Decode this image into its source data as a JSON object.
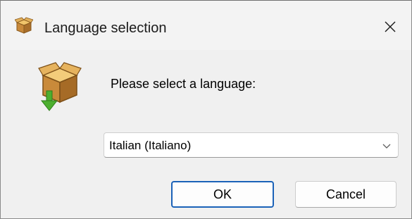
{
  "window": {
    "title": "Language selection",
    "icon": "installer-box-icon",
    "close_icon": "close-icon"
  },
  "dialog": {
    "icon": "installer-box-download-icon",
    "prompt": "Please select a language:"
  },
  "language_select": {
    "value": "Italian (Italiano)",
    "icon": "chevron-down-icon"
  },
  "buttons": {
    "ok": "OK",
    "cancel": "Cancel"
  },
  "colors": {
    "accent": "#1b62b8",
    "box": "#c8893a",
    "arrow": "#4caf2f"
  }
}
